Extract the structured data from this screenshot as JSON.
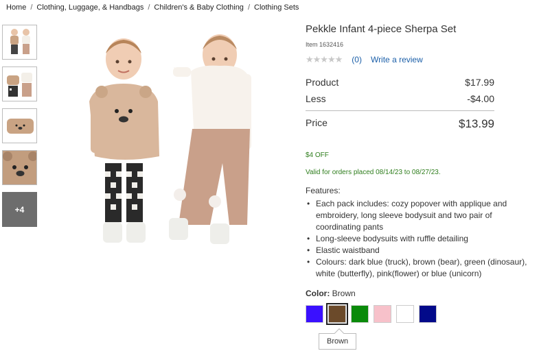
{
  "breadcrumb": [
    {
      "label": "Home"
    },
    {
      "label": "Clothing, Luggage, & Handbags"
    },
    {
      "label": "Children's & Baby Clothing"
    },
    {
      "label": "Clothing Sets"
    }
  ],
  "thumbnails": {
    "more_label": "+4"
  },
  "product": {
    "title": "Pekkle Infant 4-piece Sherpa Set",
    "item_number": "Item  1632416",
    "stars": "★★★★★",
    "review_count": "(0)",
    "write_review": "Write a review"
  },
  "pricing": {
    "product_label": "Product",
    "product_price": "$17.99",
    "less_label": "Less",
    "less_amount": "-$4.00",
    "price_label": "Price",
    "price_amount": "$13.99"
  },
  "promo": {
    "off": "$4 OFF",
    "valid": "Valid for orders placed 08/14/23 to 08/27/23."
  },
  "features": {
    "heading": "Features:",
    "items": [
      "Each pack includes: cozy popover with applique and embroidery, long sleeve bodysuit and two pair of coordinating pants",
      "Long-sleeve bodysuits with ruffle detailing",
      "Elastic waistband",
      "Colours: dark blue (truck), brown (bear), green (dinosaur), white (butterfly), pink(flower) or blue (unicorn)"
    ]
  },
  "color": {
    "label": "Color:",
    "selected": "Brown",
    "swatches": [
      "#3a10ff",
      "#6b4a2a",
      "#0a8a0a",
      "#f7c1ca",
      "#ffffff",
      "#020a8a"
    ],
    "tooltip": "Brown"
  }
}
